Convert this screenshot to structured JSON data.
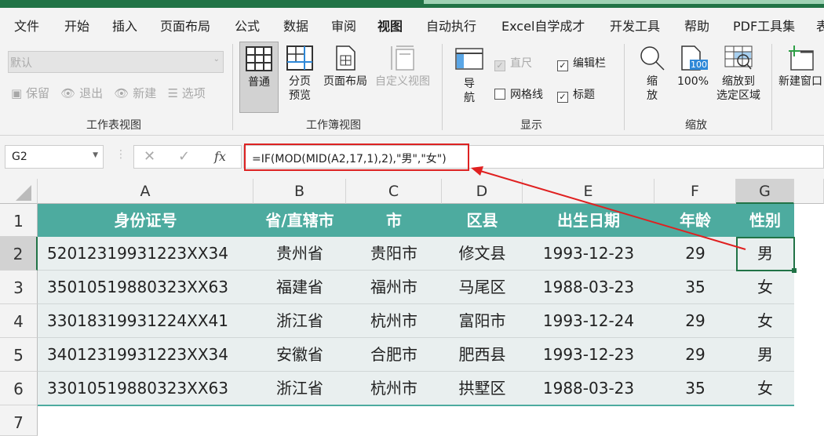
{
  "tabs": [
    "文件",
    "开始",
    "插入",
    "页面布局",
    "公式",
    "数据",
    "审阅",
    "视图",
    "自动执行",
    "Excel自学成才",
    "开发工具",
    "帮助",
    "PDF工具集",
    "表"
  ],
  "active_tab": "视图",
  "ribbon": {
    "sheet_view": {
      "dropdown_value": "默认",
      "keep": "保留",
      "exit": "退出",
      "new": "新建",
      "options": "选项",
      "label": "工作表视图"
    },
    "workbook_view": {
      "normal": "普通",
      "page_break_1": "分页",
      "page_break_2": "预览",
      "page_layout": "页面布局",
      "custom": "自定义视图",
      "label": "工作簿视图"
    },
    "show": {
      "nav_1": "导",
      "nav_2": "航",
      "ruler": "直尺",
      "formula_bar": "编辑栏",
      "gridlines": "网格线",
      "headings": "标题",
      "label": "显示",
      "ruler_checked": true,
      "formula_bar_checked": true,
      "gridlines_checked": false,
      "headings_checked": true
    },
    "zoom": {
      "zoom_1": "缩",
      "zoom_2": "放",
      "hundred": "100%",
      "hundred_icon": "100",
      "sel_1": "缩放到",
      "sel_2": "选定区域",
      "label": "缩放"
    },
    "window": {
      "new_window": "新建窗口"
    }
  },
  "formula_bar": {
    "name_box": "G2",
    "fx": "fx",
    "formula": "=IF(MOD(MID(A2,17,1),2),\"男\",\"女\")"
  },
  "columns": [
    "A",
    "B",
    "C",
    "D",
    "E",
    "F",
    "G"
  ],
  "rows": [
    "1",
    "2",
    "3",
    "4",
    "5",
    "6",
    "7"
  ],
  "table": {
    "headers": [
      "身份证号",
      "省/直辖市",
      "市",
      "区县",
      "出生日期",
      "年龄",
      "性别"
    ],
    "data": [
      [
        "52012319931223XX34",
        "贵州省",
        "贵阳市",
        "修文县",
        "1993-12-23",
        "29",
        "男"
      ],
      [
        "35010519880323XX63",
        "福建省",
        "福州市",
        "马尾区",
        "1988-03-23",
        "35",
        "女"
      ],
      [
        "33018319931224XX41",
        "浙江省",
        "杭州市",
        "富阳市",
        "1993-12-24",
        "29",
        "女"
      ],
      [
        "34012319931223XX34",
        "安徽省",
        "合肥市",
        "肥西县",
        "1993-12-23",
        "29",
        "男"
      ],
      [
        "33010519880323XX63",
        "浙江省",
        "杭州市",
        "拱墅区",
        "1988-03-23",
        "35",
        "女"
      ]
    ]
  },
  "colors": {
    "accent": "#217346",
    "header_fill": "#4dab9f",
    "data_fill": "#e9efef",
    "annotation": "#dd2222"
  }
}
